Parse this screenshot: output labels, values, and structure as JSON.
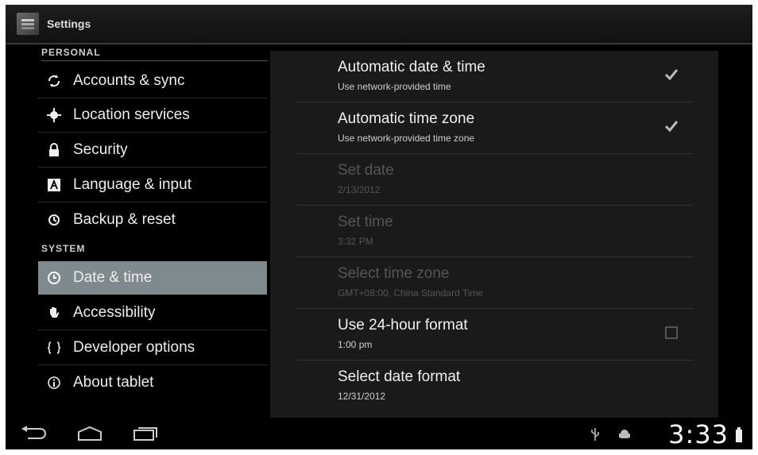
{
  "actionbar": {
    "title": "Settings",
    "icon": "settings-icon"
  },
  "left": {
    "personal_header": "PERSONAL",
    "personal_items": [
      {
        "label": "Accounts & sync",
        "icon": "sync-icon"
      },
      {
        "label": "Location services",
        "icon": "location-icon"
      },
      {
        "label": "Security",
        "icon": "lock-icon"
      },
      {
        "label": "Language & input",
        "icon": "keyboard-icon"
      },
      {
        "label": "Backup & reset",
        "icon": "backup-icon"
      }
    ],
    "system_header": "SYSTEM",
    "system_items": [
      {
        "label": "Date & time",
        "icon": "clock-icon",
        "selected": true
      },
      {
        "label": "Accessibility",
        "icon": "hand-icon"
      },
      {
        "label": "Developer options",
        "icon": "braces-icon"
      },
      {
        "label": "About tablet",
        "icon": "info-icon"
      }
    ]
  },
  "prefs": [
    {
      "title": "Automatic date & time",
      "summary": "Use network-provided time",
      "checked": true,
      "enabled": true
    },
    {
      "title": "Automatic time zone",
      "summary": "Use network-provided time zone",
      "checked": true,
      "enabled": true
    },
    {
      "title": "Set date",
      "summary": "2/13/2012",
      "enabled": false
    },
    {
      "title": "Set time",
      "summary": "3:32 PM",
      "enabled": false
    },
    {
      "title": "Select time zone",
      "summary": "GMT+08:00, China Standard Time",
      "enabled": false
    },
    {
      "title": "Use 24-hour format",
      "summary": "1:00 pm",
      "checked": false,
      "enabled": true
    },
    {
      "title": "Select date format",
      "summary": "12/31/2012",
      "enabled": true
    }
  ],
  "navbar": {
    "clock": "3:33",
    "buttons": [
      "back-icon",
      "home-icon",
      "recent-apps-icon"
    ],
    "status_icons": [
      "usb-icon",
      "android-debug-icon",
      "battery-icon"
    ]
  },
  "colors": {
    "selected_bg": "#7f8a8e",
    "pane_bg": "#1a1a1a",
    "screen_bg": "#000000"
  }
}
